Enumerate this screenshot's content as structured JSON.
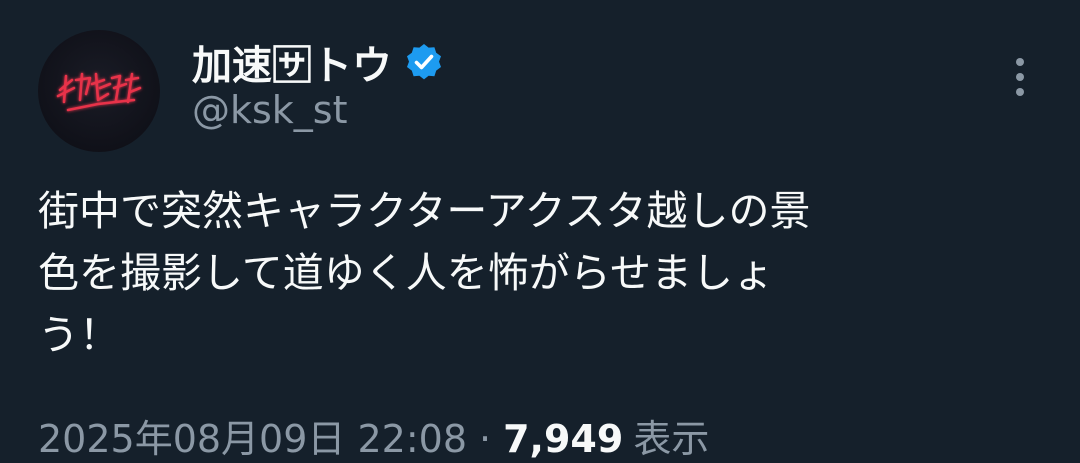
{
  "author": {
    "display_name": "加速🈂トウ",
    "handle": "@ksk_st",
    "verified_icon": "verified-badge-icon",
    "avatar_icon": "avatar-neon-signature"
  },
  "tweet": {
    "text_lines": [
      "街中で突然キャラクターアクスタ越しの景",
      "色を撮影して道ゆく人を怖がらせましょ",
      "う！"
    ]
  },
  "meta": {
    "timestamp": "2025年08月09日 22:08",
    "separator": "·",
    "views_count": "7,949",
    "views_label": "表示"
  },
  "actions": {
    "more_icon": "more-vertical-icon"
  },
  "colors": {
    "background": "#15202b",
    "text_primary": "#f7f9f9",
    "text_secondary": "#8b98a5",
    "verified": "#1d9bf0",
    "neon": "#e8334a"
  }
}
